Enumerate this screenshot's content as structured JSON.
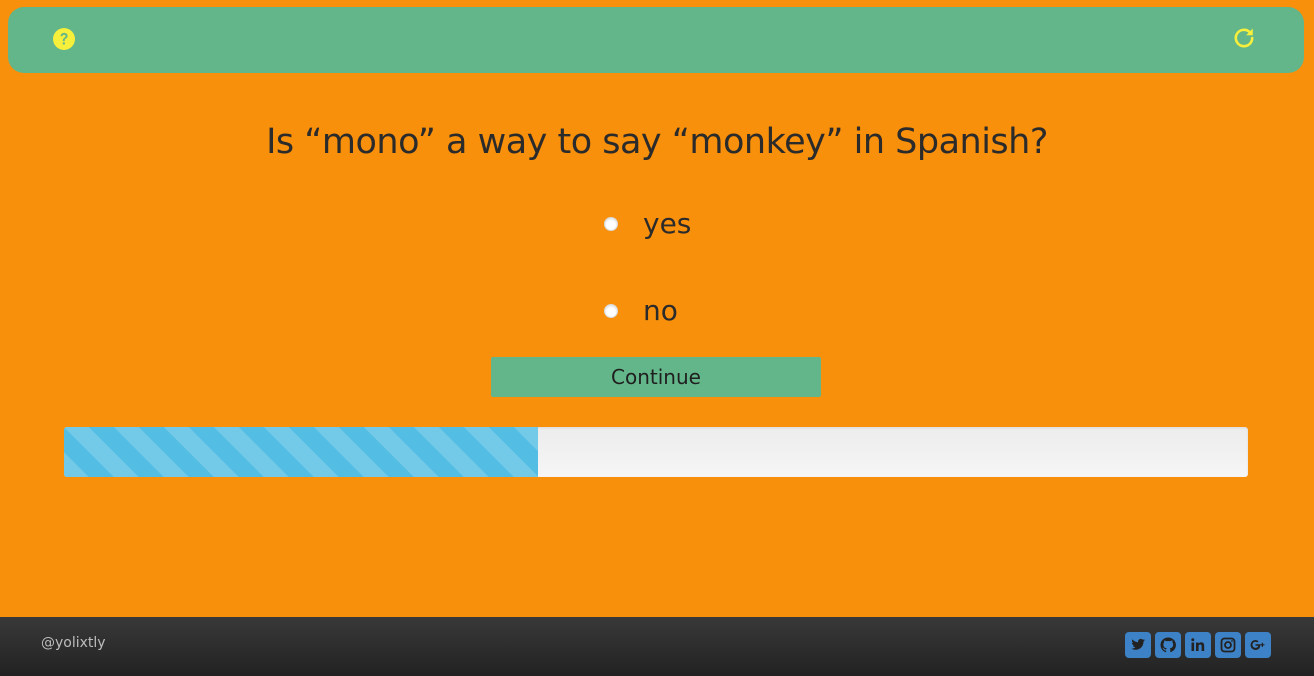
{
  "header": {
    "help_icon": "question-circle-icon",
    "reload_icon": "refresh-icon",
    "icon_color": "#f6ef3b"
  },
  "quiz": {
    "question": "Is “mono” a way to say “monkey” in Spanish?",
    "options": [
      {
        "label": "yes",
        "selected": false
      },
      {
        "label": "no",
        "selected": false
      }
    ],
    "continue_label": "Continue",
    "progress_fraction": 0.4
  },
  "footer": {
    "handle": "@yolixtly",
    "social_icons": [
      "twitter-icon",
      "github-icon",
      "linkedin-icon",
      "instagram-icon",
      "google-plus-icon"
    ]
  },
  "colors": {
    "background": "#f9900b",
    "accent_green": "#63b58a",
    "progress_blue": "#53bde3",
    "social_blue": "#3d82c7"
  }
}
